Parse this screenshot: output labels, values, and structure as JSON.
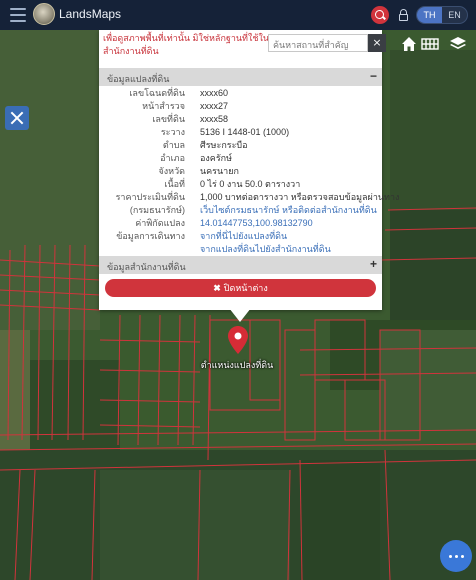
{
  "header": {
    "title": "LandsMaps",
    "lang_th": "TH",
    "lang_en": "EN",
    "lang_active": "TH"
  },
  "search": {
    "placeholder": "ค้นหาสถานที่สำคัญ",
    "clear": "×"
  },
  "popup": {
    "notice_line1": "เพื่อดูสภาพพื้นที่เท่านั้น มิใช่หลักฐานที่ใช้ในทางกฎหมาย",
    "notice_line2": "สำนักงานที่ดิน",
    "parcel_section_title": "ข้อมูลแปลงที่ดิน",
    "parcel_section_toggle": "−",
    "office_section_title": "ข้อมูลสำนักงานที่ดิน",
    "office_section_toggle": "+",
    "rows": [
      {
        "label": "เลขโฉนดที่ดิน",
        "value": "xxxx60"
      },
      {
        "label": "หน้าสำรวจ",
        "value": "xxxx27"
      },
      {
        "label": "เลขที่ดิน",
        "value": "xxxx58"
      },
      {
        "label": "ระวาง",
        "value": "5136 I 1448-01 (1000)"
      },
      {
        "label": "ตำบล",
        "value": "ศีรษะกระบือ"
      },
      {
        "label": "อำเภอ",
        "value": "องครักษ์"
      },
      {
        "label": "จังหวัด",
        "value": "นครนายก"
      },
      {
        "label": "เนื้อที่",
        "value": "0 ไร่ 0 งาน 50.0 ตารางวา"
      },
      {
        "label": "ราคาประเมินที่ดิน",
        "value": "1,000 บาทต่อตารางวา หรือตรวจสอบข้อมูลผ่านทาง"
      },
      {
        "label": "(กรมธนารักษ์)",
        "value": "เว็บไซต์กรมธนารักษ์ หรือติดต่อสำนักงานที่ดิน"
      },
      {
        "label": "ค่าพิกัดแปลง",
        "value": "14.01447753,100.98132790"
      },
      {
        "label": "ข้อมูลการเดินทาง",
        "value": "จากที่นี่ไปยังแปลงที่ดิน"
      },
      {
        "label": "",
        "value": "จากแปลงที่ดินไปยังสำนักงานที่ดิน"
      }
    ],
    "close_label": "ปิดหน้าต่าง"
  },
  "map": {
    "pin_label": "ตำแหน่งแปลงที่ดิน"
  },
  "icons": {
    "menu": "hamburger-icon",
    "logo": "logo-icon",
    "search": "search-icon",
    "lock": "lock-icon",
    "home": "home-icon",
    "grid": "grid-icon",
    "layers": "layers-icon",
    "tool": "tool-icon",
    "pin": "map-pin-icon",
    "more": "more-icon"
  },
  "colors": {
    "topbar": "#152238",
    "accent_red": "#d0343c",
    "accent_blue": "#3a78d8",
    "link_blue": "#3a6fb8"
  }
}
